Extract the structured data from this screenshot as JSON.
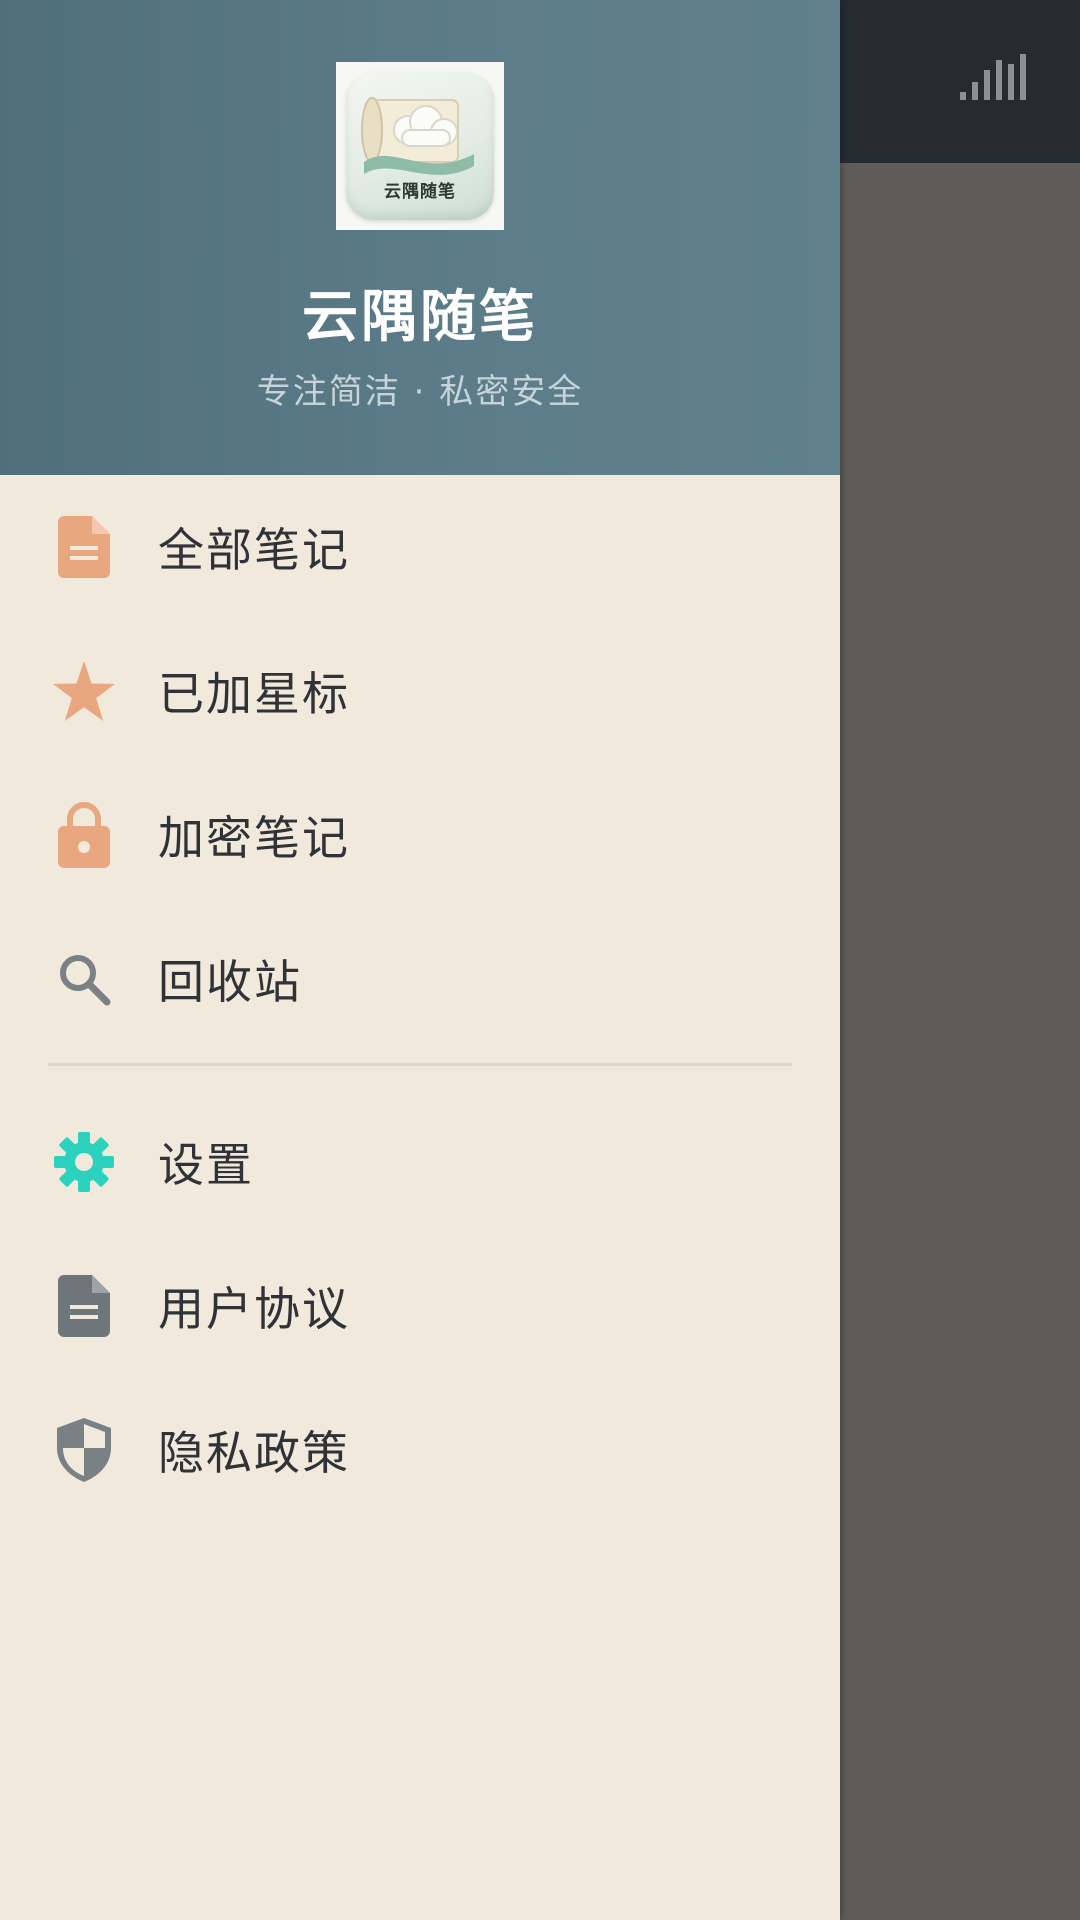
{
  "app": {
    "logo_text": "云隅随笔",
    "title": "云隅随笔",
    "subtitle": "专注简洁 · 私密安全"
  },
  "menu_primary": [
    {
      "label": "全部笔记",
      "icon": "document-icon",
      "color": "#e8a77f"
    },
    {
      "label": "已加星标",
      "icon": "star-icon",
      "color": "#e8a77f"
    },
    {
      "label": "加密笔记",
      "icon": "lock-icon",
      "color": "#e8a77f"
    },
    {
      "label": "回收站",
      "icon": "search-icon",
      "color": "#7a8185"
    }
  ],
  "menu_secondary": [
    {
      "label": "设置",
      "icon": "gear-icon",
      "color": "#2bd3bf"
    },
    {
      "label": "用户协议",
      "icon": "document-icon",
      "color": "#6f7679"
    },
    {
      "label": "隐私政策",
      "icon": "shield-icon",
      "color": "#7a8185"
    }
  ],
  "colors": {
    "header_bg": "#5a7b87",
    "drawer_bg": "#f1e9dc",
    "accent_orange": "#e8a77f",
    "accent_teal": "#2bd3bf",
    "text_primary": "#2f3337"
  }
}
